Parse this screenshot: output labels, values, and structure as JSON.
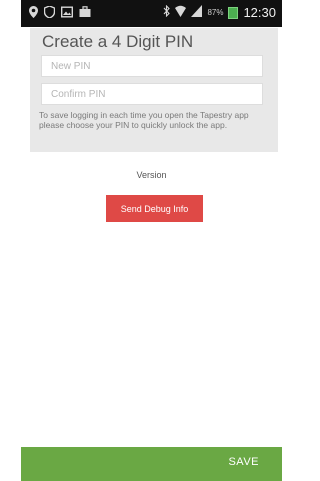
{
  "status_bar": {
    "icons_left": [
      "location-icon",
      "shield-icon",
      "image-icon",
      "briefcase-icon"
    ],
    "icons_right": [
      "bluetooth-icon",
      "wifi-icon",
      "signal-icon",
      "battery-icon"
    ],
    "battery_percent": "87%",
    "time": "12:30",
    "colors": {
      "background": "#111111",
      "battery": "#4caf50"
    }
  },
  "pin_card": {
    "title": "Create a 4 Digit PIN",
    "new_pin_placeholder": "New PIN",
    "confirm_pin_placeholder": "Confirm PIN",
    "help_text": "To save logging in each time you open the Tapestry app please choose your PIN to quickly unlock the app."
  },
  "version_label": "Version",
  "debug_button": {
    "label": "Send Debug Info",
    "color": "#df4946"
  },
  "save_bar": {
    "label": "SAVE",
    "color": "#6aa844"
  }
}
